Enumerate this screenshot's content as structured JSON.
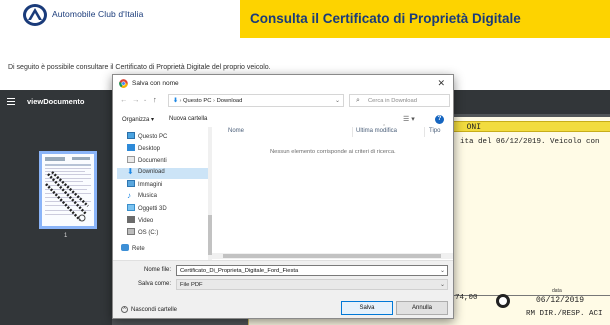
{
  "header": {
    "brand": "Automobile Club d'Italia",
    "banner_title": "Consulta il Certificato di Proprietà Digitale"
  },
  "intro_text": "Di seguito è possibile consultare il Certificato di Proprietà Digitale del proprio veicolo.",
  "viewer": {
    "title": "viewDocumento",
    "thumb_page": "1",
    "doc": {
      "bar_text": "ONI",
      "line1": "ita del 06/12/2019. Veicolo con",
      "amount": "74,00",
      "data_label": "data",
      "date": "06/12/2019",
      "resp": "RM DIR./RESP. ACI"
    }
  },
  "dialog": {
    "title": "Salva con nome",
    "address": {
      "path": [
        "Questo PC",
        "Download"
      ],
      "separator": "›"
    },
    "search_placeholder": "Cerca in Download",
    "commands": {
      "organize": "Organizza ▾",
      "new_folder": "Nuova cartella"
    },
    "tree": [
      {
        "label": "Questo PC",
        "icon": "pc-icon"
      },
      {
        "label": "Desktop",
        "icon": "desktop-folder-icon"
      },
      {
        "label": "Documenti",
        "icon": "documents-folder-icon"
      },
      {
        "label": "Download",
        "icon": "download-folder-icon",
        "selected": true
      },
      {
        "label": "Immagini",
        "icon": "pictures-folder-icon"
      },
      {
        "label": "Musica",
        "icon": "music-folder-icon"
      },
      {
        "label": "Oggetti 3D",
        "icon": "3d-objects-folder-icon"
      },
      {
        "label": "Video",
        "icon": "video-folder-icon"
      },
      {
        "label": "OS (C:)",
        "icon": "drive-icon"
      },
      {
        "label": "Rete",
        "icon": "network-icon"
      }
    ],
    "columns": {
      "name": "Nome",
      "modified": "Ultima modifica",
      "type": "Tipo"
    },
    "empty_message": "Nessun elemento corrisponde ai criteri di ricerca.",
    "filename_label": "Nome file:",
    "filename_value": "Certificato_Di_Proprieta_Digitale_Ford_Fiesta",
    "savetype_label": "Salva come:",
    "savetype_value": "File PDF",
    "hide_folders": "Nascondi cartelle",
    "save_button": "Salva",
    "cancel_button": "Annulla"
  },
  "colors": {
    "banner": "#fdd300",
    "brand_blue": "#1a3b7a",
    "selected_bg": "#cce4f7",
    "primary_border": "#0078d7"
  }
}
